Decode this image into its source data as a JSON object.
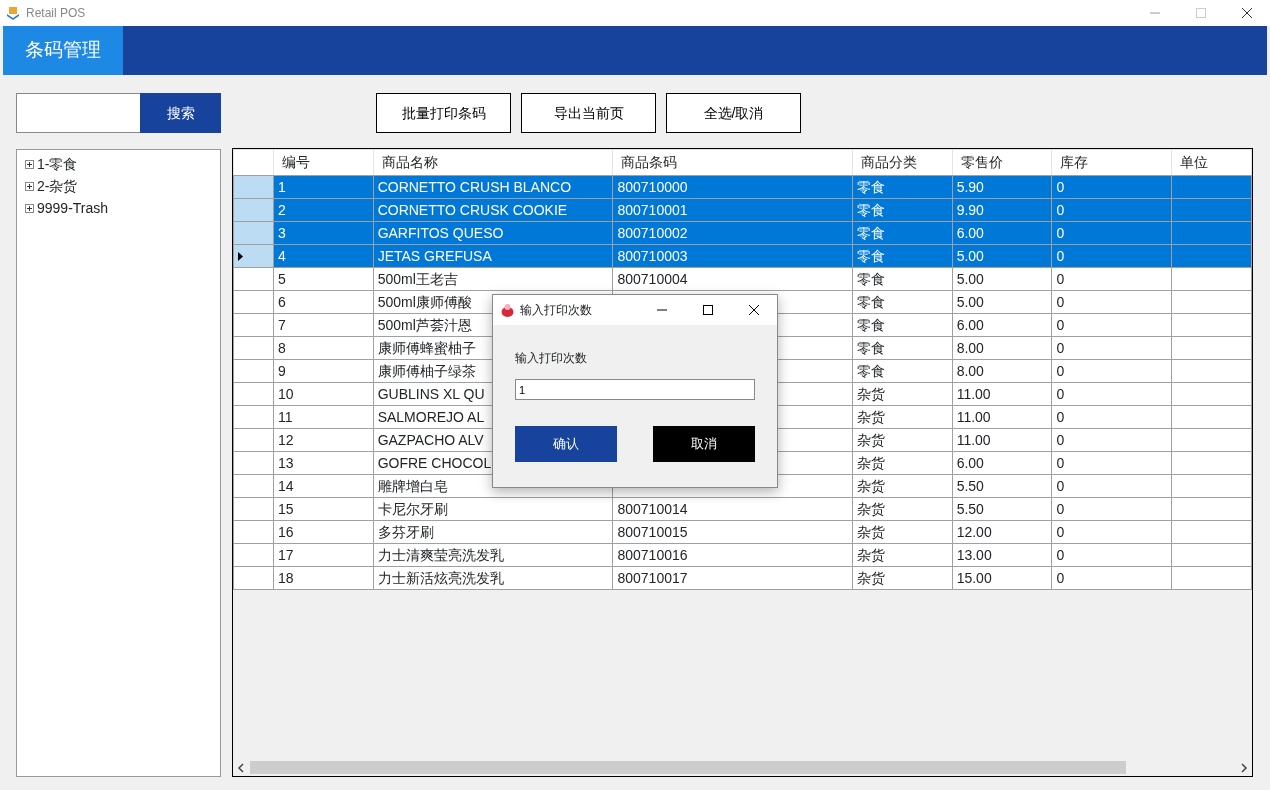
{
  "window": {
    "title": "Retail POS"
  },
  "header": {
    "tab": "条码管理"
  },
  "search": {
    "button": "搜索"
  },
  "toolbar": [
    "批量打印条码",
    "导出当前页",
    "全选/取消"
  ],
  "tree": [
    {
      "label": "1-零食",
      "expanded": false
    },
    {
      "label": "2-杂货",
      "expanded": false
    },
    {
      "label": "9999-Trash",
      "expanded": false
    }
  ],
  "table": {
    "columns": [
      "编号",
      "商品名称",
      "商品条码",
      "商品分类",
      "零售价",
      "库存",
      "单位"
    ],
    "rows": [
      {
        "id": "1",
        "name": "CORNETTO CRUSH BLANCO",
        "barcode": "800710000",
        "category": "零食",
        "price": "5.90",
        "stock": "0",
        "selected": true,
        "current": false
      },
      {
        "id": "2",
        "name": "CORNETTO CRUSK COOKIE",
        "barcode": "800710001",
        "category": "零食",
        "price": "9.90",
        "stock": "0",
        "selected": true,
        "current": false
      },
      {
        "id": "3",
        "name": "GARFITOS QUESO",
        "barcode": "800710002",
        "category": "零食",
        "price": "6.00",
        "stock": "0",
        "selected": true,
        "current": false
      },
      {
        "id": "4",
        "name": "JETAS GREFUSA",
        "barcode": "800710003",
        "category": "零食",
        "price": "5.00",
        "stock": "0",
        "selected": true,
        "current": true
      },
      {
        "id": "5",
        "name": "500ml王老吉",
        "barcode": "800710004",
        "category": "零食",
        "price": "5.00",
        "stock": "0",
        "selected": false,
        "current": false
      },
      {
        "id": "6",
        "name": "500ml康师傅酸",
        "category": "零食",
        "price": "5.00",
        "stock": "0",
        "selected": false,
        "current": false
      },
      {
        "id": "7",
        "name": "500ml芦荟汁恩",
        "category": "零食",
        "price": "6.00",
        "stock": "0",
        "selected": false,
        "current": false
      },
      {
        "id": "8",
        "name": "康师傅蜂蜜柚子",
        "category": "零食",
        "price": "8.00",
        "stock": "0",
        "selected": false,
        "current": false
      },
      {
        "id": "9",
        "name": "康师傅柚子绿茶",
        "category": "零食",
        "price": "8.00",
        "stock": "0",
        "selected": false,
        "current": false
      },
      {
        "id": "10",
        "name": "GUBLINS XL QU",
        "category": "杂货",
        "price": "11.00",
        "stock": "0",
        "selected": false,
        "current": false
      },
      {
        "id": "11",
        "name": "SALMOREJO AL",
        "category": "杂货",
        "price": "11.00",
        "stock": "0",
        "selected": false,
        "current": false
      },
      {
        "id": "12",
        "name": "GAZPACHO ALV",
        "category": "杂货",
        "price": "11.00",
        "stock": "0",
        "selected": false,
        "current": false
      },
      {
        "id": "13",
        "name": "GOFRE CHOCOL",
        "category": "杂货",
        "price": "6.00",
        "stock": "0",
        "selected": false,
        "current": false
      },
      {
        "id": "14",
        "name": "雕牌增白皂",
        "category": "杂货",
        "price": "5.50",
        "stock": "0",
        "selected": false,
        "current": false
      },
      {
        "id": "15",
        "name": "卡尼尔牙刷",
        "barcode": "800710014",
        "category": "杂货",
        "price": "5.50",
        "stock": "0",
        "selected": false,
        "current": false
      },
      {
        "id": "16",
        "name": "多芬牙刷",
        "barcode": "800710015",
        "category": "杂货",
        "price": "12.00",
        "stock": "0",
        "selected": false,
        "current": false
      },
      {
        "id": "17",
        "name": "力士清爽莹亮洗发乳",
        "barcode": "800710016",
        "category": "杂货",
        "price": "13.00",
        "stock": "0",
        "selected": false,
        "current": false
      },
      {
        "id": "18",
        "name": "力士新活炫亮洗发乳",
        "barcode": "800710017",
        "category": "杂货",
        "price": "15.00",
        "stock": "0",
        "selected": false,
        "current": false
      }
    ]
  },
  "dialog": {
    "title": "输入打印次数",
    "label": "输入打印次数",
    "value": "1",
    "ok": "确认",
    "cancel": "取消"
  }
}
